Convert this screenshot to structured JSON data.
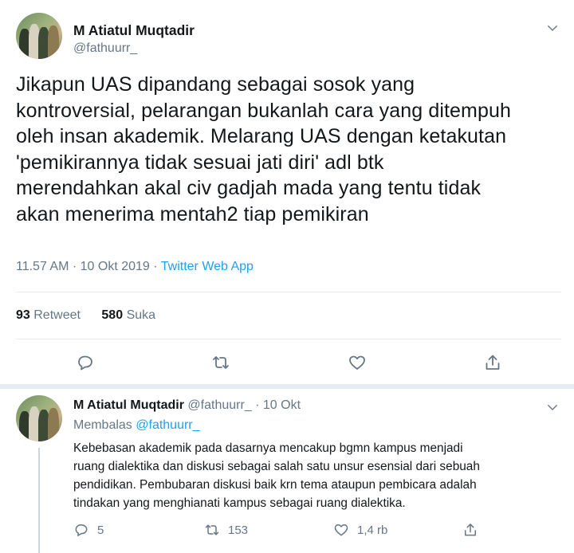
{
  "main_tweet": {
    "author_name": "M Atiatul Muqtadir",
    "author_handle": "@fathuurr_",
    "text": "Jikapun UAS dipandang sebagai sosok yang\nkontroversial, pelarangan bukanlah cara yang ditempuh\noleh insan akademik. Melarang UAS dengan ketakutan\n'pemikirannya tidak sesuai jati diri' adl btk\nmerendahkan akal civ gadjah mada yang tentu tidak\nakan menerima mentah2 tiap pemikiran",
    "time": "11.57 AM",
    "separator": " · ",
    "date": "10 Okt 2019",
    "source": "Twitter Web App",
    "retweet_count": "93",
    "retweet_label": "Retweet",
    "like_count": "580",
    "like_label": "Suka"
  },
  "reply_tweet": {
    "author_name": "M Atiatul Muqtadir",
    "author_handle": "@fathuurr_",
    "separator": " · ",
    "date": "10 Okt",
    "replying_prefix": "Membalas ",
    "replying_to": "@fathuurr_",
    "text": "Kebebasan akademik pada dasarnya mencakup bgmn kampus menjadi\nruang dialektika dan diskusi sebagai salah satu unsur esensial dari sebuah\npendidikan. Pembubaran diskusi baik krn tema ataupun pembicara adalah\ntindakan yang menghianati kampus sebagai ruang dialektika.",
    "reply_count": "5",
    "retweet_count": "153",
    "like_count": "1,4 rb"
  },
  "icons": {
    "reply": "reply-icon",
    "retweet": "retweet-icon",
    "like": "heart-icon",
    "share": "share-icon",
    "more": "chevron-down-icon"
  },
  "colors": {
    "accent": "#1da1f2",
    "secondary_text": "#657786",
    "divider": "#e6ecf0"
  }
}
